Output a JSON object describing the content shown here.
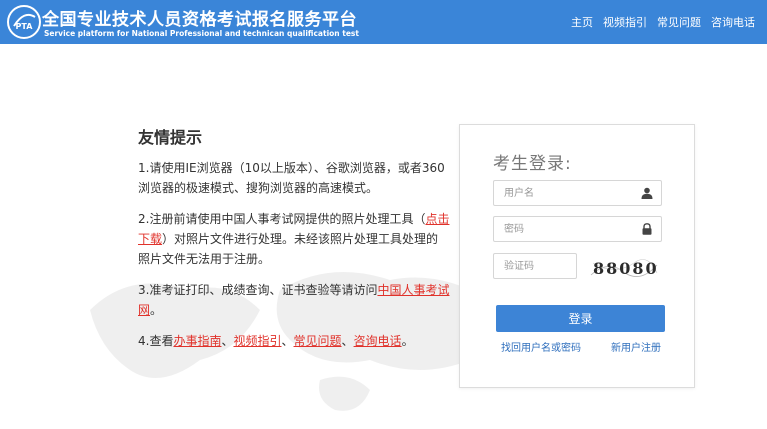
{
  "header": {
    "title": "全国专业技术人员资格考试报名服务平台",
    "subtitle": "Service platform for National Professional and technican qualification test",
    "logo_text": "PTA",
    "nav": [
      "主页",
      "视频指引",
      "常见问题",
      "咨询电话"
    ]
  },
  "tips": {
    "title": "友情提示",
    "tip1": "1.请使用IE浏览器（10以上版本）、谷歌浏览器，或者360浏览器的极速模式、搜狗浏览器的高速模式。",
    "tip2_before": "2.注册前请使用中国人事考试网提供的照片处理工具（",
    "tip2_link": "点击下载",
    "tip2_after": "）对照片文件进行处理。未经该照片处理工具处理的照片文件无法用于注册。",
    "tip3_before": "3.准考证打印、成绩查询、证书查验等请访问",
    "tip3_link": "中国人事考试网",
    "tip3_after": "。",
    "tip4_before": "4.查看",
    "tip4_links": [
      "办事指南",
      "视频指引",
      "常见问题",
      "咨询电话"
    ],
    "tip4_sep": "、",
    "tip4_after": "。"
  },
  "login": {
    "title": "考生登录:",
    "username_placeholder": "用户名",
    "password_placeholder": "密码",
    "captcha_placeholder": "验证码",
    "captcha_code": "88080",
    "login_button": "登录",
    "forgot_link": "找回用户名或密码",
    "register_link": "新用户注册"
  },
  "colors": {
    "header_bg": "#3a85d8",
    "link_red": "#e0322b",
    "button_blue": "#3d84d6"
  }
}
